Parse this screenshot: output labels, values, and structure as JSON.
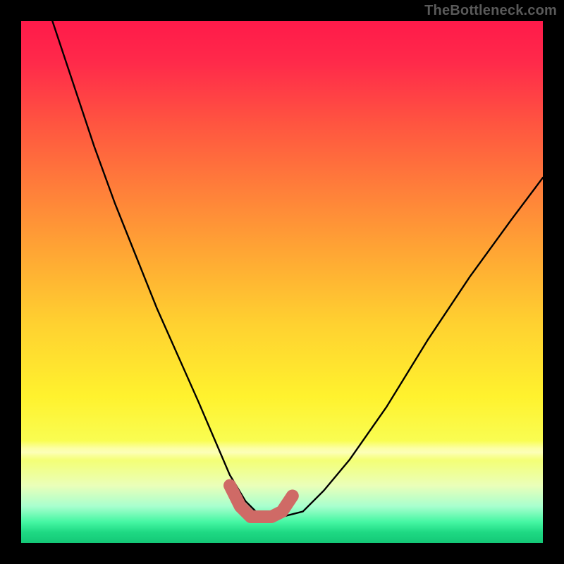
{
  "watermark": "TheBottleneck.com",
  "chart_data": {
    "type": "line",
    "title": "",
    "xlabel": "",
    "ylabel": "",
    "xlim": [
      0,
      100
    ],
    "ylim": [
      0,
      100
    ],
    "grid": false,
    "series": [
      {
        "name": "bottleneck-curve",
        "x": [
          6,
          10,
          14,
          18,
          22,
          26,
          30,
          34,
          37,
          40,
          43,
          46,
          50,
          54,
          58,
          63,
          70,
          78,
          86,
          94,
          100
        ],
        "values": [
          100,
          88,
          76,
          65,
          55,
          45,
          36,
          27,
          20,
          13,
          8,
          5,
          5,
          6,
          10,
          16,
          26,
          39,
          51,
          62,
          70
        ]
      },
      {
        "name": "marker-segment",
        "x": [
          40,
          42,
          44,
          46,
          48,
          50,
          52
        ],
        "values": [
          11,
          7,
          5,
          5,
          5,
          6,
          9
        ]
      }
    ],
    "background_gradient": {
      "top_color": "#ff1a4a",
      "bottom_color": "#14c877"
    }
  }
}
